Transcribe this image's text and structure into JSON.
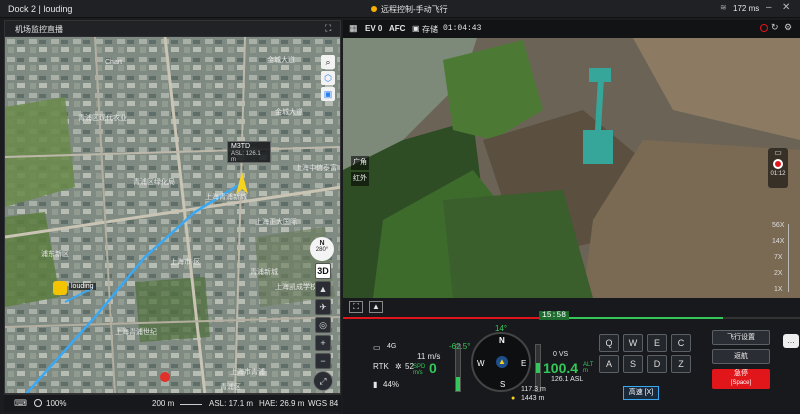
{
  "titlebar": {
    "app_title": "Dock 2 | louding",
    "mode_text": "远程控制-手动飞行",
    "latency": "172 ms"
  },
  "map": {
    "panel_title": "机场监控直播",
    "labels": [
      {
        "text": "Chart",
        "size": "s"
      },
      {
        "text": "金城大道",
        "size": "s"
      },
      {
        "text": "青浦区现代农业",
        "size": "s"
      },
      {
        "text": "上海中信泰富",
        "size": "s"
      },
      {
        "text": "金城大道",
        "size": "s"
      },
      {
        "text": "青浦区绿化局",
        "size": "s"
      },
      {
        "text": "上海青浦新城",
        "size": "s"
      },
      {
        "text": "上海正大国际",
        "size": "s"
      },
      {
        "text": "浦东新区",
        "size": "s"
      },
      {
        "text": "上海市·区",
        "size": "s"
      },
      {
        "text": "青浦新城",
        "size": "s"
      },
      {
        "text": "上海凯成学校",
        "size": "s"
      },
      {
        "text": "上海青浦世纪",
        "size": "s"
      },
      {
        "text": "上海市青浦",
        "size": "s"
      },
      {
        "text": "青浦区",
        "size": "s"
      }
    ],
    "drone_label": "M3TD",
    "drone_asl": "ASL: 126.1 m",
    "dock_label": "louding",
    "compass_heading": "280°",
    "layer_label": "3D"
  },
  "statusbar": {
    "zoom": "100%",
    "scale": "200 m",
    "asl": "ASL: 17.1 m",
    "hae": "HAE: 26.9 m",
    "crs": "WGS 84"
  },
  "camera": {
    "ev": "EV 0",
    "afc": "AFC",
    "storage": "存储",
    "rec_time": "01:04:43",
    "lens_wide": "广角",
    "lens_ir": "红外",
    "zoom_levels": [
      "56X",
      "14X",
      "7X",
      "2X",
      "1X"
    ],
    "rec_timer": "01:12",
    "progress_time": "15:58"
  },
  "flight": {
    "signal": "4G",
    "rtk_label": "RTK",
    "rtk_sats": "52",
    "battery": "44%",
    "hspd": "11 m/s",
    "spd_value": "0",
    "spd_unit": "SPD m/s",
    "gimbal_pitch": "-62.5°",
    "heading": "14°",
    "vs": "0 VS",
    "alt_value": "100.4",
    "alt_unit": "ALT m",
    "asl": "126.1 ASL",
    "dist1": "117.3 m",
    "dist2": "1443 m",
    "compass": [
      "N",
      "E",
      "S",
      "W",
      "3",
      "6",
      "12",
      "15",
      "21",
      "24",
      "30",
      "33"
    ]
  },
  "keys": {
    "row1": [
      "Q",
      "W",
      "E",
      "C"
    ],
    "row2": [
      "A",
      "S",
      "D",
      "Z"
    ],
    "speed_btn": "高速 [X]"
  },
  "actions": {
    "settings": "飞行设置",
    "rth": "返航",
    "estop": "急停",
    "estop_key": "[Space]"
  },
  "colors": {
    "accent_green": "#35c759",
    "alert_red": "#e0161b",
    "route_blue": "#3aa8f2"
  }
}
